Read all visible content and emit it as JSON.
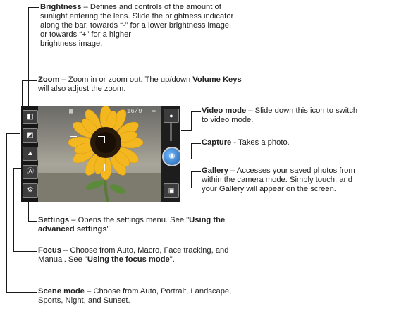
{
  "brightness": {
    "title": "Brightness",
    "text_1": " – Defines and controls of the amount of",
    "text_2": "sunlight entering the lens. Slide the brightness indicator",
    "text_3": "along the bar, towards “-” for a lower brightness image,",
    "text_4": "or towards “+” for a higher",
    "text_5": "brightness image."
  },
  "zoom": {
    "title": "Zoom",
    "text_1a": " – Zoom in or zoom out. The up/down ",
    "text_1b": "Volume Keys",
    "text_2": "will also adjust the zoom."
  },
  "video_mode": {
    "title": "Video mode",
    "text_1": " – Slide down this icon to switch",
    "text_2": "to video mode."
  },
  "capture": {
    "title": "Capture",
    "text_1": " - Takes a photo."
  },
  "gallery": {
    "title": "Gallery",
    "text_1": " – Accesses your saved photos from",
    "text_2": "within the camera mode. Simply touch, and",
    "text_3": "your Gallery will appear on the screen."
  },
  "settings": {
    "title": "Settings",
    "text_1": " – Opens the settings menu. See \"",
    "link_1": "Using the",
    "link_2": "advanced settings",
    "text_2": "\"."
  },
  "focus": {
    "title": "Focus",
    "text_1": " – Choose from Auto, Macro, Face tracking, and",
    "text_2a": "Manual. See \"",
    "link": "Using the focus mode",
    "text_2b": "\"."
  },
  "scene": {
    "title": "Scene mode",
    "text_1": " – Choose from Auto, Portrait, Landscape,",
    "text_2": "Sports, Night, and Sunset."
  },
  "screen_status": {
    "shots": "16/9"
  }
}
